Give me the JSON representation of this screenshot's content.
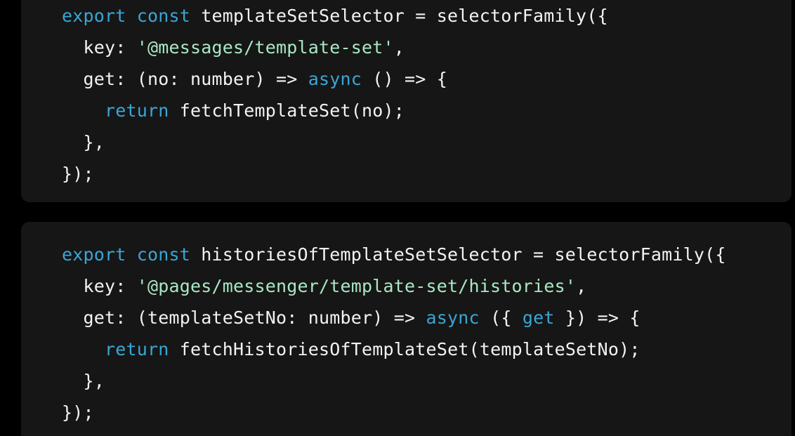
{
  "code_blocks": [
    {
      "lines": [
        [
          {
            "t": "export const",
            "c": "kw"
          },
          {
            "t": " templateSetSelector = selectorFamily({",
            "c": ""
          }
        ],
        [
          {
            "t": "  key: ",
            "c": ""
          },
          {
            "t": "'@messages/template-set'",
            "c": "str"
          },
          {
            "t": ",",
            "c": ""
          }
        ],
        [
          {
            "t": "  get: (no: number) => ",
            "c": ""
          },
          {
            "t": "async",
            "c": "kw"
          },
          {
            "t": " () => {",
            "c": ""
          }
        ],
        [
          {
            "t": "    ",
            "c": ""
          },
          {
            "t": "return",
            "c": "kw"
          },
          {
            "t": " fetchTemplateSet(no);",
            "c": ""
          }
        ],
        [
          {
            "t": "  },",
            "c": ""
          }
        ],
        [
          {
            "t": "});",
            "c": ""
          }
        ]
      ]
    },
    {
      "lines": [
        [
          {
            "t": "export const",
            "c": "kw"
          },
          {
            "t": " historiesOfTemplateSetSelector = selectorFamily({",
            "c": ""
          }
        ],
        [
          {
            "t": "  key: ",
            "c": ""
          },
          {
            "t": "'@pages/messenger/template-set/histories'",
            "c": "str"
          },
          {
            "t": ",",
            "c": ""
          }
        ],
        [
          {
            "t": "  get: (templateSetNo: number) => ",
            "c": ""
          },
          {
            "t": "async",
            "c": "kw"
          },
          {
            "t": " ({ ",
            "c": ""
          },
          {
            "t": "get",
            "c": "kw"
          },
          {
            "t": " }) => {",
            "c": ""
          }
        ],
        [
          {
            "t": "    ",
            "c": ""
          },
          {
            "t": "return",
            "c": "kw"
          },
          {
            "t": " fetchHistoriesOfTemplateSet(templateSetNo);",
            "c": ""
          }
        ],
        [
          {
            "t": "  },",
            "c": ""
          }
        ],
        [
          {
            "t": "});",
            "c": ""
          }
        ]
      ]
    }
  ],
  "colors": {
    "background": "#000000",
    "block_background": "#161616",
    "text": "#f3f3f3",
    "keyword": "#3aa6d6",
    "string": "#a9e8c4"
  }
}
